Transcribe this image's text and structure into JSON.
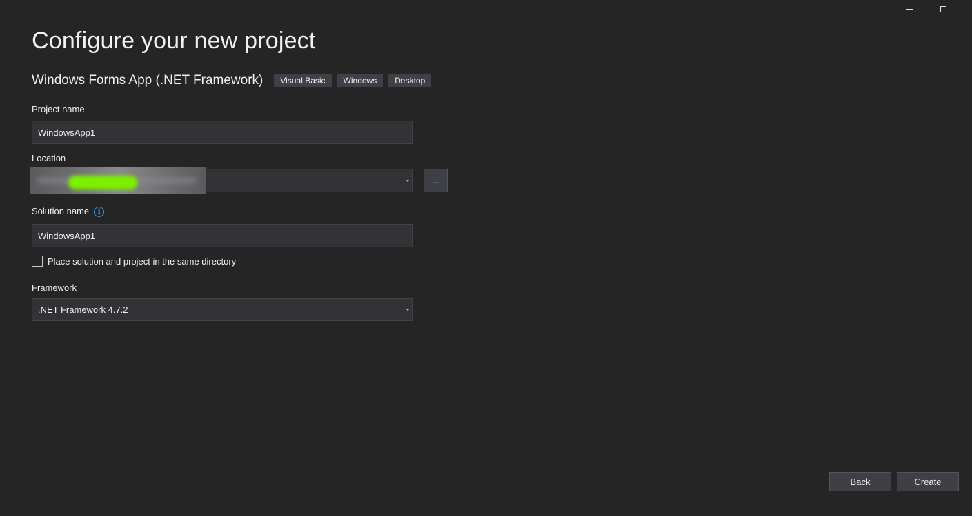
{
  "header": {
    "title": "Configure your new project"
  },
  "template": {
    "name": "Windows Forms App (.NET Framework)",
    "tags": [
      "Visual Basic",
      "Windows",
      "Desktop"
    ]
  },
  "project_name": {
    "label": "Project name",
    "value": "WindowsApp1"
  },
  "location": {
    "label": "Location",
    "value": "",
    "browse_label": "..."
  },
  "solution_name": {
    "label": "Solution name",
    "info_icon": "info-icon",
    "value": "WindowsApp1"
  },
  "same_directory": {
    "label": "Place solution and project in the same directory",
    "checked": false
  },
  "framework": {
    "label": "Framework",
    "value": ".NET Framework 4.7.2"
  },
  "footer": {
    "back_label": "Back",
    "create_label": "Create"
  },
  "colors": {
    "background": "#252526",
    "input_background": "#333337",
    "button_background": "#3f3f46",
    "accent_info": "#3794ff",
    "redaction_highlight": "#7cf000"
  }
}
